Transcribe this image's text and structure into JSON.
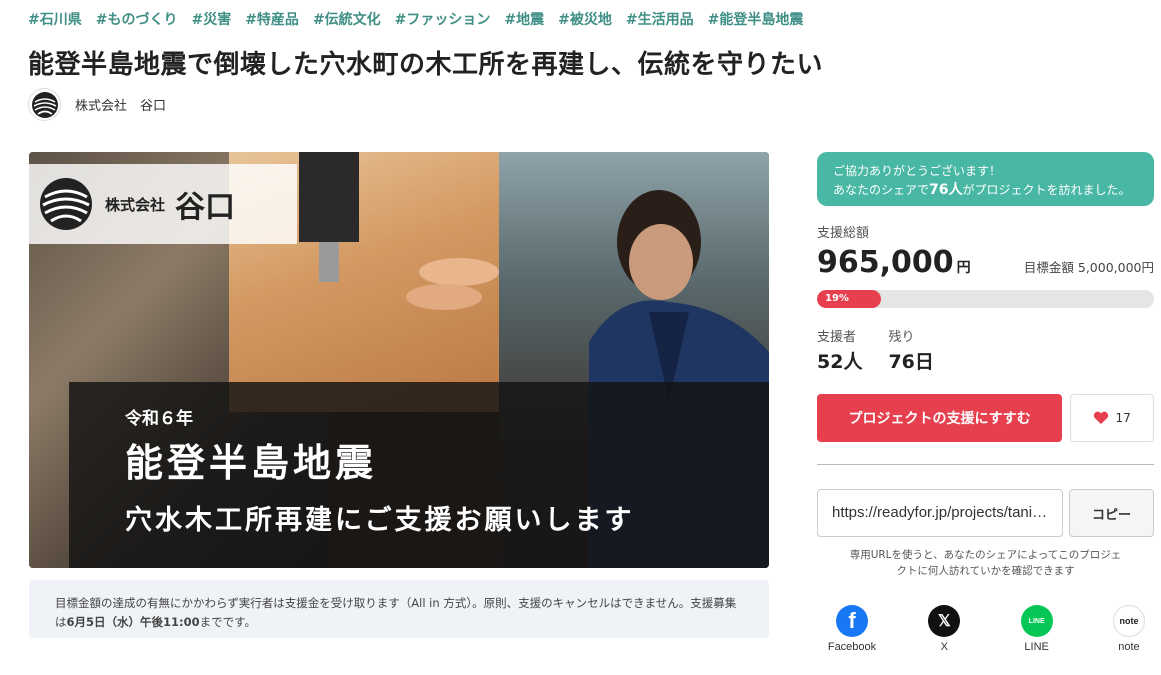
{
  "tags": [
    "#石川県",
    "#ものづくり",
    "#災害",
    "#特産品",
    "#伝統文化",
    "#ファッション",
    "#地震",
    "#被災地",
    "#生活用品",
    "#能登半島地震"
  ],
  "title": "能登半島地震で倒壊した穴水町の木工所を再建し、伝統を守りたい",
  "owner": {
    "name": "株式会社　谷口"
  },
  "hero": {
    "logo_company": "株式会社",
    "logo_name": "谷口",
    "sub": "令和６年",
    "main": "能登半島地震",
    "line2": "穴水木工所再建にご支援お願いします"
  },
  "notice": {
    "text1": "目標金額の達成の有無にかかわらず実行者は支援金を受け取ります（All in 方式）。原則、支援のキャンセルはできません。支援募集は",
    "deadline": "6月5日（水）午後11:00",
    "text2": "までです。"
  },
  "sidebar": {
    "thanks_line1": "ご協力ありがとうございます！",
    "thanks_pre": "あなたのシェアで",
    "thanks_count": "76人",
    "thanks_post": "がプロジェクトを訪れました。",
    "total_label": "支援総額",
    "total_amount": "965,000",
    "total_unit": "円",
    "goal_text": "目標金額 5,000,000円",
    "progress_percent": 19,
    "progress_label": "19%",
    "supporters_label": "支援者",
    "supporters_value": "52人",
    "remaining_label": "残り",
    "remaining_value": "76日",
    "cta_label": "プロジェクトの支援にすすむ",
    "fav_count": "17",
    "share_url": "https://readyfor.jp/projects/taniguchi-anamizu",
    "copy_label": "コピー",
    "share_note": "専用URLを使うと、あなたのシェアによってこのプロジェクトに何人訪れていかを確認できます",
    "sns": [
      {
        "label": "Facebook",
        "color": "#1877f2",
        "icon": "facebook-icon"
      },
      {
        "label": "X",
        "color": "#111111",
        "icon": "x-icon"
      },
      {
        "label": "LINE",
        "color": "#06c755",
        "icon": "line-icon"
      },
      {
        "label": "note",
        "color": "#ffffff",
        "icon": "note-icon"
      }
    ]
  }
}
